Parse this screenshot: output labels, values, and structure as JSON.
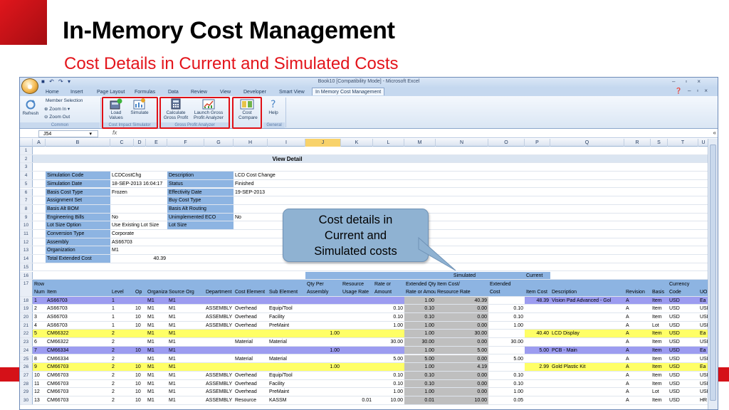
{
  "slide": {
    "title": "In-Memory Cost Management",
    "subtitle": "Cost Details in Current and Simulated Costs",
    "brand_color": "#d51118"
  },
  "excel": {
    "window_title": "Book10  [Compatibility Mode]  -  Microsoft Excel",
    "qat_icons": [
      "save-icon",
      "undo-icon",
      "redo-icon",
      "customize-icon"
    ],
    "tabs": [
      "Home",
      "Insert",
      "Page Layout",
      "Formulas",
      "Data",
      "Review",
      "View",
      "Developer",
      "Smart View",
      "In Memory Cost Management"
    ],
    "active_tab": "In Memory Cost Management",
    "ribbon": {
      "refresh": "Refresh",
      "member_selection": "Member Selection",
      "zoom_in": "Zoom In",
      "zoom_out": "Zoom Out",
      "common_group": "Common",
      "load_values": "Load Values",
      "simulate": "Simulate",
      "cost_impact_group": "Cost Impact Simulator",
      "calculate_gross_profit": "Calculate Gross Profit",
      "launch_gross_profit_analyzer": "Launch Gross Profit Analyzer",
      "gross_profit_group": "Gross Profit Analyzer",
      "cost_compare": "Cost Compare",
      "help": "Help",
      "general_group": "General"
    },
    "name_box": "J54",
    "fx": "fx",
    "columns": [
      "A",
      "B",
      "C",
      "D",
      "E",
      "F",
      "G",
      "H",
      "I",
      "J",
      "K",
      "L",
      "M",
      "N",
      "O",
      "P",
      "Q",
      "R",
      "S",
      "T",
      "U"
    ],
    "selected_column": "J",
    "view_detail": "View Detail",
    "header_info": {
      "left_labels": [
        "Simulation Code",
        "Simulation Date",
        "Basis Cost Type",
        "Assignment Set",
        "Basis Alt BOM",
        "Engineering Bills",
        "Lot Size Option",
        "Conversion Type",
        "Assembly",
        "Organization",
        "Total Extended Cost"
      ],
      "left_values": [
        "LCDCostChg",
        "18-SEP-2013 16:04:17",
        "Frozen",
        "",
        "",
        "No",
        "Use Existing Lot Size",
        "Corporate",
        "AS66703",
        "M1",
        "40.39"
      ],
      "right_labels": [
        "Description",
        "Status",
        "Effectivity Date",
        "Buy Cost Type",
        "Basis Alt Routing",
        "Unimplemented ECO",
        "Lot Size"
      ],
      "right_values": [
        "LCD Cost Change",
        "Finished",
        "19-SEP-2013",
        "",
        "",
        "No",
        ""
      ]
    },
    "section_labels": {
      "simulated": "Simulated",
      "current": "Current"
    },
    "table_headers": {
      "line1": [
        "Row",
        "",
        "",
        "",
        "",
        "",
        "",
        "",
        "",
        "Qty Per",
        "Resource",
        "Rate or",
        "Extended Qty/",
        "Item Cost/",
        "Extended",
        "",
        "",
        "",
        "",
        "Currency",
        ""
      ],
      "line2": [
        "Num",
        "Item",
        "Level",
        "Op",
        "Organization",
        "Source Org",
        "Department",
        "Cost Element",
        "Sub Element",
        "Assembly",
        "Usage Rate",
        "Amount",
        "Rate or Amount",
        "Resource Rate",
        "Cost",
        "Item Cost",
        "Description",
        "Revision",
        "Basis",
        "Code",
        "UOM"
      ]
    },
    "rows": [
      {
        "rownum": "18",
        "style": "purple",
        "cells": [
          "1",
          "AS66703",
          "1",
          "",
          "M1",
          "M1",
          "",
          "",
          "",
          "",
          "",
          "",
          "1.00",
          "40.39",
          "",
          "48.39",
          "Vision Pad Advanced - Gol",
          "A",
          "Item",
          "USD",
          "Ea"
        ]
      },
      {
        "rownum": "19",
        "style": "white",
        "cells": [
          "2",
          "AS66703",
          "1",
          "10",
          "M1",
          "M1",
          "ASSEMBLY",
          "Overhead",
          "Equip/Tool",
          "",
          "",
          "0.10",
          "0.10",
          "0.00",
          "0.10",
          "",
          "",
          "A",
          "Item",
          "USD",
          "USD"
        ]
      },
      {
        "rownum": "20",
        "style": "white",
        "cells": [
          "3",
          "AS66703",
          "1",
          "10",
          "M1",
          "M1",
          "ASSEMBLY",
          "Overhead",
          "Facility",
          "",
          "",
          "0.10",
          "0.10",
          "0.00",
          "0.10",
          "",
          "",
          "A",
          "Item",
          "USD",
          "USD"
        ]
      },
      {
        "rownum": "21",
        "style": "white",
        "cells": [
          "4",
          "AS66703",
          "1",
          "10",
          "M1",
          "M1",
          "ASSEMBLY",
          "Overhead",
          "PreMaint",
          "",
          "",
          "1.00",
          "1.00",
          "0.00",
          "1.00",
          "",
          "",
          "A",
          "Lot",
          "USD",
          "USD"
        ]
      },
      {
        "rownum": "22",
        "style": "yellow",
        "cells": [
          "5",
          "CM66322",
          "2",
          "",
          "M1",
          "M1",
          "",
          "",
          "",
          "1.00",
          "",
          "",
          "1.00",
          "30.00",
          "",
          "40.40",
          "LCD Display",
          "A",
          "Item",
          "USD",
          "Ea"
        ]
      },
      {
        "rownum": "23",
        "style": "white",
        "cells": [
          "6",
          "CM66322",
          "2",
          "",
          "M1",
          "M1",
          "",
          "Material",
          "Material",
          "",
          "",
          "30.00",
          "30.00",
          "0.00",
          "30.00",
          "",
          "",
          "A",
          "Item",
          "USD",
          "USD"
        ]
      },
      {
        "rownum": "24",
        "style": "purple",
        "cells": [
          "7",
          "CM66334",
          "2",
          "10",
          "M1",
          "M1",
          "",
          "",
          "",
          "1.00",
          "",
          "",
          "1.00",
          "5.00",
          "",
          "5.00",
          "PCB - Main",
          "A",
          "Item",
          "USD",
          "Ea"
        ]
      },
      {
        "rownum": "25",
        "style": "white",
        "cells": [
          "8",
          "CM66334",
          "2",
          "",
          "M1",
          "M1",
          "",
          "Material",
          "Material",
          "",
          "",
          "5.00",
          "5.00",
          "0.00",
          "5.00",
          "",
          "",
          "A",
          "Item",
          "USD",
          "USD"
        ]
      },
      {
        "rownum": "26",
        "style": "yellow",
        "cells": [
          "9",
          "CM66703",
          "2",
          "10",
          "M1",
          "M1",
          "",
          "",
          "",
          "1.00",
          "",
          "",
          "1.00",
          "4.19",
          "",
          "2.99",
          "Gold Plastic Kit",
          "A",
          "Item",
          "USD",
          "Ea"
        ]
      },
      {
        "rownum": "27",
        "style": "white",
        "cells": [
          "10",
          "CM66703",
          "2",
          "10",
          "M1",
          "M1",
          "ASSEMBLY",
          "Overhead",
          "Equip/Tool",
          "",
          "",
          "0.10",
          "0.10",
          "0.00",
          "0.10",
          "",
          "",
          "A",
          "Item",
          "USD",
          "USD"
        ]
      },
      {
        "rownum": "28",
        "style": "white",
        "cells": [
          "11",
          "CM66703",
          "2",
          "10",
          "M1",
          "M1",
          "ASSEMBLY",
          "Overhead",
          "Facility",
          "",
          "",
          "0.10",
          "0.10",
          "0.00",
          "0.10",
          "",
          "",
          "A",
          "Item",
          "USD",
          "USD"
        ]
      },
      {
        "rownum": "29",
        "style": "white",
        "cells": [
          "12",
          "CM66703",
          "2",
          "10",
          "M1",
          "M1",
          "ASSEMBLY",
          "Overhead",
          "PreMaint",
          "",
          "",
          "1.00",
          "1.00",
          "0.00",
          "1.00",
          "",
          "",
          "A",
          "Lot",
          "USD",
          "USD"
        ]
      },
      {
        "rownum": "30",
        "style": "white",
        "cells": [
          "13",
          "CM66703",
          "2",
          "10",
          "M1",
          "M1",
          "ASSEMBLY",
          "Resource",
          "KASSM",
          "",
          "0.01",
          "10.00",
          "0.01",
          "10.00",
          "0.05",
          "",
          "",
          "A",
          "Item",
          "USD",
          "HR"
        ]
      }
    ],
    "colors": {
      "purple": "#9c9cf0",
      "yellow": "#ffff66",
      "blue_header": "#8db4e2",
      "gray_col": "#bfbfbf",
      "selected_col": "#f8d26a"
    }
  },
  "callout": {
    "line1": "Cost details in",
    "line2": "Current and",
    "line3": "Simulated costs"
  }
}
